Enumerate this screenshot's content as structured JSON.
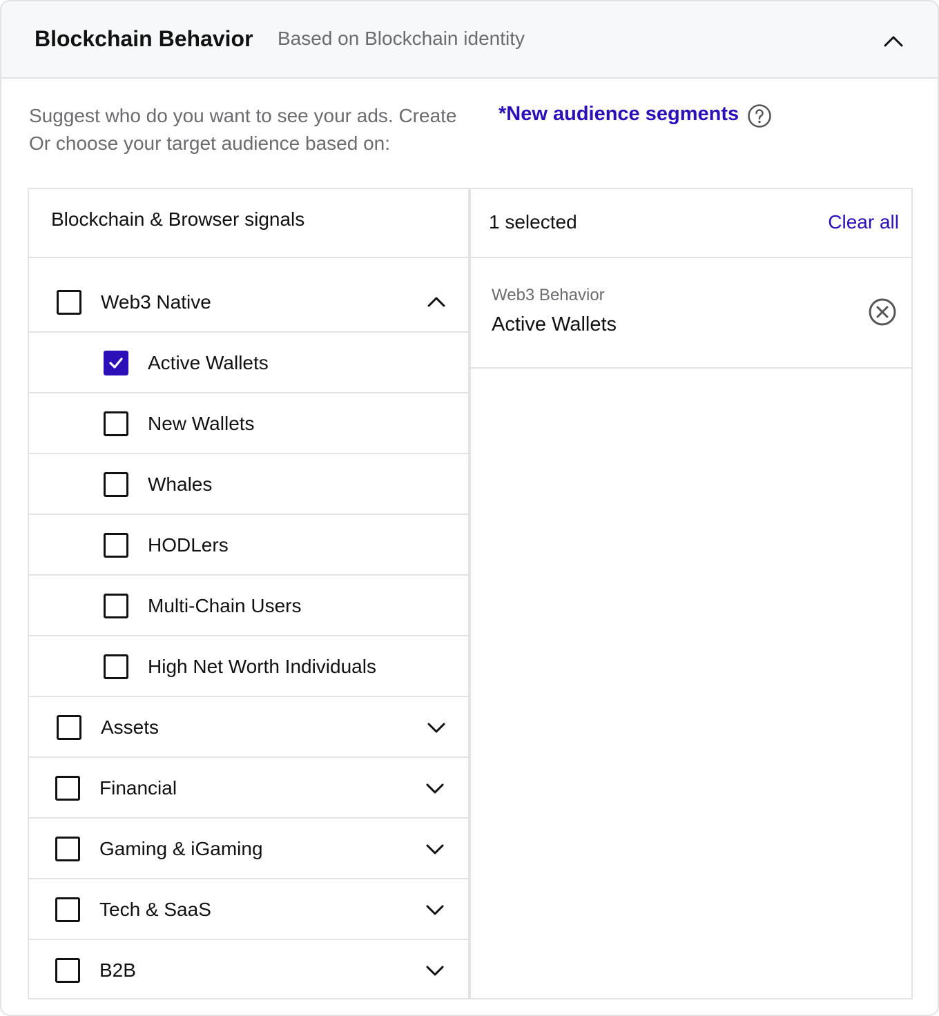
{
  "header": {
    "title": "Blockchain Behavior",
    "subtitle": "Based on Blockchain identity",
    "collapse_icon": "chevron-up-icon"
  },
  "intro": {
    "line1": "Suggest who do you want to see your ads. Create",
    "link": "*New audience segments",
    "help_icon": "question-circle-icon",
    "line2": "Or choose your target audience based on:"
  },
  "left_panel": {
    "title": "Blockchain & Browser signals",
    "groups": [
      {
        "label": "Web3 Native",
        "expanded": true,
        "checked": false,
        "children": [
          {
            "label": "Active Wallets",
            "checked": true
          },
          {
            "label": "New Wallets",
            "checked": false
          },
          {
            "label": "Whales",
            "checked": false
          },
          {
            "label": "HODLers",
            "checked": false
          },
          {
            "label": "Multi-Chain Users",
            "checked": false
          },
          {
            "label": "High Net Worth Individuals",
            "checked": false
          }
        ]
      },
      {
        "label": "Assets",
        "expanded": false,
        "checked": false
      },
      {
        "label": "Financial",
        "expanded": false,
        "checked": false
      },
      {
        "label": "Gaming & iGaming",
        "expanded": false,
        "checked": false
      },
      {
        "label": "Tech & SaaS",
        "expanded": false,
        "checked": false
      },
      {
        "label": "B2B",
        "expanded": false,
        "checked": false
      }
    ]
  },
  "right_panel": {
    "selected_count": "1 selected",
    "clear_all": "Clear all",
    "items": [
      {
        "category": "Web3 Behavior",
        "name": "Active Wallets",
        "remove_icon": "close-circle-icon"
      }
    ]
  },
  "colors": {
    "accent": "#2d0fb8",
    "muted_text": "#6b6b70",
    "border": "#e3e3e6",
    "header_bg": "#f7f8fa"
  }
}
